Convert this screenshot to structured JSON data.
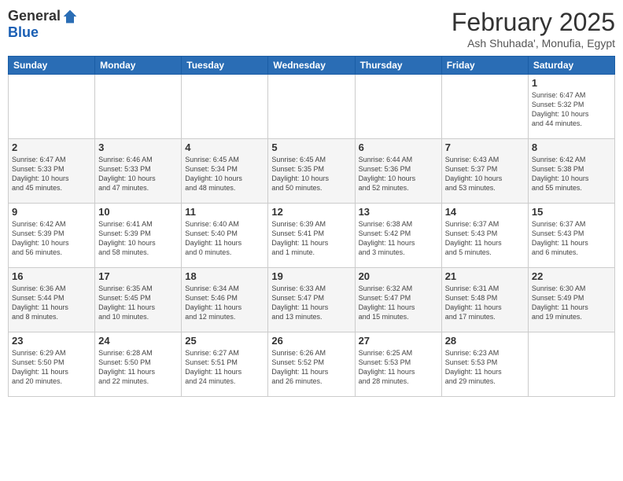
{
  "logo": {
    "general": "General",
    "blue": "Blue"
  },
  "header": {
    "month": "February 2025",
    "location": "Ash Shuhada', Monufia, Egypt"
  },
  "days_of_week": [
    "Sunday",
    "Monday",
    "Tuesday",
    "Wednesday",
    "Thursday",
    "Friday",
    "Saturday"
  ],
  "weeks": [
    [
      {
        "num": "",
        "info": "",
        "empty": true
      },
      {
        "num": "",
        "info": "",
        "empty": true
      },
      {
        "num": "",
        "info": "",
        "empty": true
      },
      {
        "num": "",
        "info": "",
        "empty": true
      },
      {
        "num": "",
        "info": "",
        "empty": true
      },
      {
        "num": "",
        "info": "",
        "empty": true
      },
      {
        "num": "1",
        "info": "Sunrise: 6:47 AM\nSunset: 5:32 PM\nDaylight: 10 hours\nand 44 minutes.",
        "empty": false
      }
    ],
    [
      {
        "num": "2",
        "info": "Sunrise: 6:47 AM\nSunset: 5:33 PM\nDaylight: 10 hours\nand 45 minutes.",
        "empty": false
      },
      {
        "num": "3",
        "info": "Sunrise: 6:46 AM\nSunset: 5:33 PM\nDaylight: 10 hours\nand 47 minutes.",
        "empty": false
      },
      {
        "num": "4",
        "info": "Sunrise: 6:45 AM\nSunset: 5:34 PM\nDaylight: 10 hours\nand 48 minutes.",
        "empty": false
      },
      {
        "num": "5",
        "info": "Sunrise: 6:45 AM\nSunset: 5:35 PM\nDaylight: 10 hours\nand 50 minutes.",
        "empty": false
      },
      {
        "num": "6",
        "info": "Sunrise: 6:44 AM\nSunset: 5:36 PM\nDaylight: 10 hours\nand 52 minutes.",
        "empty": false
      },
      {
        "num": "7",
        "info": "Sunrise: 6:43 AM\nSunset: 5:37 PM\nDaylight: 10 hours\nand 53 minutes.",
        "empty": false
      },
      {
        "num": "8",
        "info": "Sunrise: 6:42 AM\nSunset: 5:38 PM\nDaylight: 10 hours\nand 55 minutes.",
        "empty": false
      }
    ],
    [
      {
        "num": "9",
        "info": "Sunrise: 6:42 AM\nSunset: 5:39 PM\nDaylight: 10 hours\nand 56 minutes.",
        "empty": false
      },
      {
        "num": "10",
        "info": "Sunrise: 6:41 AM\nSunset: 5:39 PM\nDaylight: 10 hours\nand 58 minutes.",
        "empty": false
      },
      {
        "num": "11",
        "info": "Sunrise: 6:40 AM\nSunset: 5:40 PM\nDaylight: 11 hours\nand 0 minutes.",
        "empty": false
      },
      {
        "num": "12",
        "info": "Sunrise: 6:39 AM\nSunset: 5:41 PM\nDaylight: 11 hours\nand 1 minute.",
        "empty": false
      },
      {
        "num": "13",
        "info": "Sunrise: 6:38 AM\nSunset: 5:42 PM\nDaylight: 11 hours\nand 3 minutes.",
        "empty": false
      },
      {
        "num": "14",
        "info": "Sunrise: 6:37 AM\nSunset: 5:43 PM\nDaylight: 11 hours\nand 5 minutes.",
        "empty": false
      },
      {
        "num": "15",
        "info": "Sunrise: 6:37 AM\nSunset: 5:43 PM\nDaylight: 11 hours\nand 6 minutes.",
        "empty": false
      }
    ],
    [
      {
        "num": "16",
        "info": "Sunrise: 6:36 AM\nSunset: 5:44 PM\nDaylight: 11 hours\nand 8 minutes.",
        "empty": false
      },
      {
        "num": "17",
        "info": "Sunrise: 6:35 AM\nSunset: 5:45 PM\nDaylight: 11 hours\nand 10 minutes.",
        "empty": false
      },
      {
        "num": "18",
        "info": "Sunrise: 6:34 AM\nSunset: 5:46 PM\nDaylight: 11 hours\nand 12 minutes.",
        "empty": false
      },
      {
        "num": "19",
        "info": "Sunrise: 6:33 AM\nSunset: 5:47 PM\nDaylight: 11 hours\nand 13 minutes.",
        "empty": false
      },
      {
        "num": "20",
        "info": "Sunrise: 6:32 AM\nSunset: 5:47 PM\nDaylight: 11 hours\nand 15 minutes.",
        "empty": false
      },
      {
        "num": "21",
        "info": "Sunrise: 6:31 AM\nSunset: 5:48 PM\nDaylight: 11 hours\nand 17 minutes.",
        "empty": false
      },
      {
        "num": "22",
        "info": "Sunrise: 6:30 AM\nSunset: 5:49 PM\nDaylight: 11 hours\nand 19 minutes.",
        "empty": false
      }
    ],
    [
      {
        "num": "23",
        "info": "Sunrise: 6:29 AM\nSunset: 5:50 PM\nDaylight: 11 hours\nand 20 minutes.",
        "empty": false
      },
      {
        "num": "24",
        "info": "Sunrise: 6:28 AM\nSunset: 5:50 PM\nDaylight: 11 hours\nand 22 minutes.",
        "empty": false
      },
      {
        "num": "25",
        "info": "Sunrise: 6:27 AM\nSunset: 5:51 PM\nDaylight: 11 hours\nand 24 minutes.",
        "empty": false
      },
      {
        "num": "26",
        "info": "Sunrise: 6:26 AM\nSunset: 5:52 PM\nDaylight: 11 hours\nand 26 minutes.",
        "empty": false
      },
      {
        "num": "27",
        "info": "Sunrise: 6:25 AM\nSunset: 5:53 PM\nDaylight: 11 hours\nand 28 minutes.",
        "empty": false
      },
      {
        "num": "28",
        "info": "Sunrise: 6:23 AM\nSunset: 5:53 PM\nDaylight: 11 hours\nand 29 minutes.",
        "empty": false
      },
      {
        "num": "",
        "info": "",
        "empty": true
      }
    ]
  ]
}
